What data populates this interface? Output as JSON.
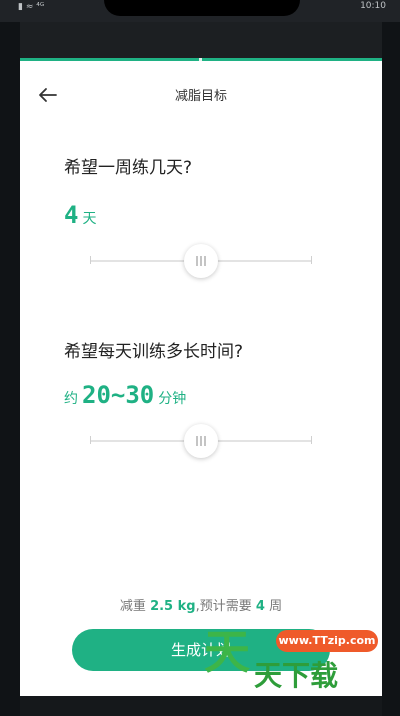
{
  "status_bar": {
    "signal_text": "▮ ≈ ⁴ᴳ",
    "time": "10:10"
  },
  "header": {
    "title": "减脂目标",
    "back_icon": "arrow-left-icon"
  },
  "questions": {
    "days": {
      "question": "希望一周练几天?",
      "value": "4",
      "unit": "天",
      "slider_fraction": 0.5
    },
    "duration": {
      "question": "希望每天训练多长时间?",
      "prefix": "约",
      "value": "20~30",
      "unit": "分钟",
      "slider_fraction": 0.5
    }
  },
  "summary": {
    "lead": "减重",
    "weight": "2.5 kg",
    "mid": ",预计需要",
    "weeks": "4",
    "tail": "周"
  },
  "cta": {
    "label": "生成计划"
  },
  "watermark": {
    "url": "www.TTzip.com",
    "big_char": "天",
    "text": "天下载"
  },
  "colors": {
    "accent": "#1fb184",
    "text": "#222222",
    "muted": "#777777"
  }
}
